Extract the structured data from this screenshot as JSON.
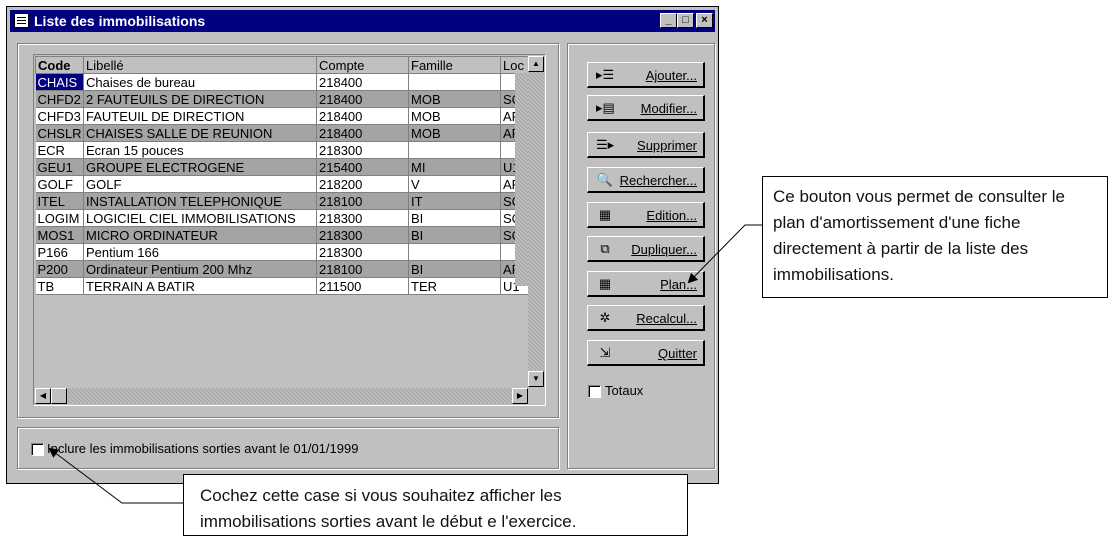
{
  "window": {
    "title": "Liste des immobilisations",
    "controls": {
      "minimize": "_",
      "maximize": "□",
      "close": "×"
    }
  },
  "table": {
    "columns": [
      "Code",
      "Libellé",
      "Compte",
      "Famille",
      "Loc"
    ],
    "rows": [
      {
        "code": "CHAIS",
        "libelle": "Chaises de bureau",
        "compte": "218400",
        "famille": "",
        "loc": ""
      },
      {
        "code": "CHFD2",
        "libelle": "2 FAUTEUILS DE DIRECTION",
        "compte": "218400",
        "famille": "MOB",
        "loc": "SC"
      },
      {
        "code": "CHFD3",
        "libelle": "FAUTEUIL DE DIRECTION",
        "compte": "218400",
        "famille": "MOB",
        "loc": "AP"
      },
      {
        "code": "CHSLR",
        "libelle": "CHAISES SALLE DE REUNION",
        "compte": "218400",
        "famille": "MOB",
        "loc": "AP"
      },
      {
        "code": "ECR",
        "libelle": "Ecran 15 pouces",
        "compte": "218300",
        "famille": "",
        "loc": ""
      },
      {
        "code": "GEU1",
        "libelle": "GROUPE ELECTROGENE",
        "compte": "215400",
        "famille": "MI",
        "loc": "U1"
      },
      {
        "code": "GOLF",
        "libelle": "GOLF",
        "compte": "218200",
        "famille": "V",
        "loc": "AP"
      },
      {
        "code": "ITEL",
        "libelle": "INSTALLATION TELEPHONIQUE",
        "compte": "218100",
        "famille": "IT",
        "loc": "SC"
      },
      {
        "code": "LOGIM",
        "libelle": "LOGICIEL CIEL IMMOBILISATIONS",
        "compte": "218300",
        "famille": "BI",
        "loc": "SC"
      },
      {
        "code": "MOS1",
        "libelle": "MICRO ORDINATEUR",
        "compte": "218300",
        "famille": "BI",
        "loc": "SC"
      },
      {
        "code": "P166",
        "libelle": "Pentium 166",
        "compte": "218300",
        "famille": "",
        "loc": ""
      },
      {
        "code": "P200",
        "libelle": "Ordinateur Pentium 200 Mhz",
        "compte": "218100",
        "famille": "BI",
        "loc": "AP"
      },
      {
        "code": "TB",
        "libelle": "TERRAIN A BATIR",
        "compte": "211500",
        "famille": "TER",
        "loc": "U1"
      }
    ]
  },
  "buttons": [
    {
      "name": "ajouter",
      "label": "Ajouter...",
      "icon": "add-record-icon",
      "glyph": "▸☰"
    },
    {
      "name": "modifier",
      "label": "Modifier...",
      "icon": "edit-record-icon",
      "glyph": "▸▤"
    },
    {
      "name": "supprimer",
      "label": "Supprimer",
      "icon": "delete-record-icon",
      "glyph": "☰▸"
    },
    {
      "name": "rechercher",
      "label": "Rechercher...",
      "icon": "magnifier-icon",
      "glyph": "🔍"
    },
    {
      "name": "edition",
      "label": "Edition...",
      "icon": "report-icon",
      "glyph": "▦"
    },
    {
      "name": "dupliquer",
      "label": "Dupliquer...",
      "icon": "duplicate-icon",
      "glyph": "⧉"
    },
    {
      "name": "plan",
      "label": "Plan...",
      "icon": "plan-icon",
      "glyph": "▦"
    },
    {
      "name": "recalcul",
      "label": "Recalcul...",
      "icon": "recalc-icon",
      "glyph": "✲"
    },
    {
      "name": "quitter",
      "label": "Quitter",
      "icon": "exit-icon",
      "glyph": "⇲"
    }
  ],
  "totaux": {
    "label": "Totaux",
    "checked": false
  },
  "include_checkbox": {
    "label": "Inclure les immobilisations sorties avant le 01/01/1999",
    "checked": false
  },
  "callouts": {
    "plan": "Ce bouton vous permet de consulter le plan d'amortissement d'une fiche directement à partir de la liste des immobilisations.",
    "include": "Cochez cette case si vous souhaitez afficher les immobilisations sorties avant le début e l'exercice."
  },
  "colors": {
    "titlebar": "#000080",
    "selection": "#000080",
    "face": "#c0c0c0",
    "row_shade": "#a4a4a4"
  }
}
